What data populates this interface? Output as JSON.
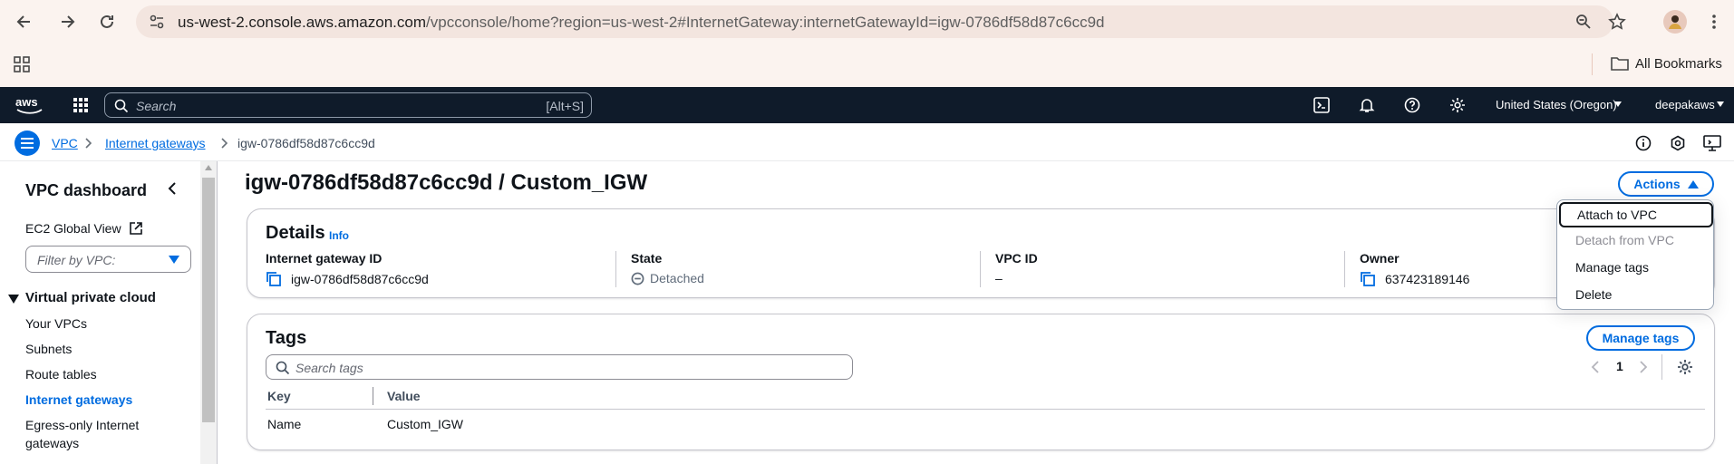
{
  "browser": {
    "url_host": "us-west-2.console.aws.amazon.com",
    "url_path": "/vpcconsole/home?region=us-west-2#InternetGateway:internetGatewayId=igw-0786df58d87c6cc9d",
    "bookmarks_label": "All Bookmarks"
  },
  "aws_nav": {
    "search_placeholder": "Search",
    "search_shortcut": "[Alt+S]",
    "region": "United States (Oregon)",
    "account": "deepakaws"
  },
  "breadcrumb": {
    "items": [
      "VPC",
      "Internet gateways"
    ],
    "current": "igw-0786df58d87c6cc9d"
  },
  "sidebar": {
    "title": "VPC dashboard",
    "ec2_global_view": "EC2 Global View",
    "filter_placeholder": "Filter by VPC:",
    "section": "Virtual private cloud",
    "items": [
      "Your VPCs",
      "Subnets",
      "Route tables",
      "Internet gateways",
      "Egress-only Internet",
      "gateways"
    ],
    "active_item": "Internet gateways"
  },
  "main": {
    "title": "igw-0786df58d87c6cc9d / Custom_IGW",
    "actions_label": "Actions",
    "details": {
      "title": "Details",
      "info": "Info",
      "fields": [
        {
          "label": "Internet gateway ID",
          "value": "igw-0786df58d87c6cc9d"
        },
        {
          "label": "State",
          "value": "Detached"
        },
        {
          "label": "VPC ID",
          "value": "–"
        },
        {
          "label": "Owner",
          "value": "637423189146"
        }
      ]
    },
    "tags": {
      "title": "Tags",
      "manage_label": "Manage tags",
      "search_placeholder": "Search tags",
      "page": "1",
      "columns": [
        "Key",
        "Value"
      ],
      "rows": [
        {
          "key": "Name",
          "value": "Custom_IGW"
        }
      ]
    }
  },
  "actions_menu": {
    "items": [
      {
        "label": "Attach to VPC",
        "state": "focused"
      },
      {
        "label": "Detach from VPC",
        "state": "disabled"
      },
      {
        "label": "Manage tags",
        "state": "enabled"
      },
      {
        "label": "Delete",
        "state": "enabled"
      }
    ]
  },
  "colors": {
    "link": "#006ce0",
    "nav_bg": "#0f1b2a",
    "chrome_bg": "#fbf3ef"
  }
}
